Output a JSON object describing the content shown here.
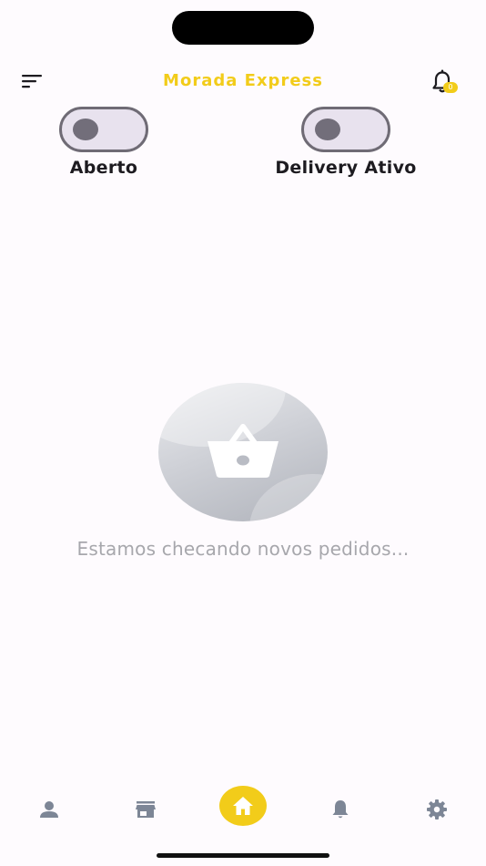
{
  "header": {
    "title": "Morada Express",
    "notification_count": "0",
    "menu_icon": "menu-icon",
    "bell_icon": "bell-icon"
  },
  "toggles": [
    {
      "label": "Aberto",
      "on": false
    },
    {
      "label": "Delivery Ativo",
      "on": false
    }
  ],
  "empty_state": {
    "icon": "basket-icon",
    "message": "Estamos checando novos pedidos..."
  },
  "bottom_nav": {
    "items": [
      {
        "icon": "person-icon"
      },
      {
        "icon": "store-icon"
      },
      {
        "icon": "home-icon",
        "active": true
      },
      {
        "icon": "bell-icon"
      },
      {
        "icon": "gear-icon"
      }
    ]
  },
  "colors": {
    "accent": "#f2cc1a",
    "background": "#fefbfe",
    "toggle_border": "#6f6b75",
    "toggle_track": "#e8e2ee",
    "nav_icon": "#7d8696",
    "muted_text": "#a7a7ac"
  }
}
